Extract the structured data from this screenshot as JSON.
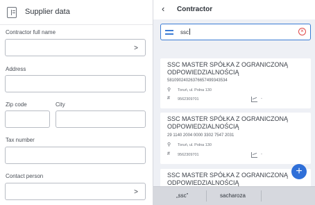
{
  "left": {
    "title": "Supplier data",
    "icon": "document-icon",
    "fields": {
      "contractor": "Contractor full name",
      "address": "Address",
      "zip": "Zip code",
      "city": "City",
      "tax": "Tax number",
      "contact": "Contact person"
    }
  },
  "right": {
    "title": "Contractor",
    "search": {
      "value": "ssc",
      "filter_icon": "filter-icon",
      "clear_icon": "clear-icon"
    },
    "results": [
      {
        "name": "SSC MASTER SPÓŁKA Z OGRANICZONĄ ODPOWIEDZIALNOŚCIĄ",
        "account": "58109024026376657499343534",
        "address": "Toruń, ul. Polna 130",
        "tax": "9562309701",
        "chart": "-"
      },
      {
        "name": "SSC MASTER SPÓŁKA Z OGRANICZONĄ ODPOWIEDZIALNOŚCIĄ",
        "account": "29 1140 2004 0000 3302 7547 2031",
        "address": "Toruń, ul. Polna 130",
        "tax": "9562309701",
        "chart": "-"
      },
      {
        "name": "SSC MASTER SPÓŁKA Z OGRANICZONĄ ODPOWIEDZIALNOŚCIĄ"
      }
    ],
    "suggestions": [
      "„ssc”",
      "sacharoza"
    ]
  },
  "colors": {
    "accent": "#2f6fd8",
    "clear": "#e04848"
  }
}
